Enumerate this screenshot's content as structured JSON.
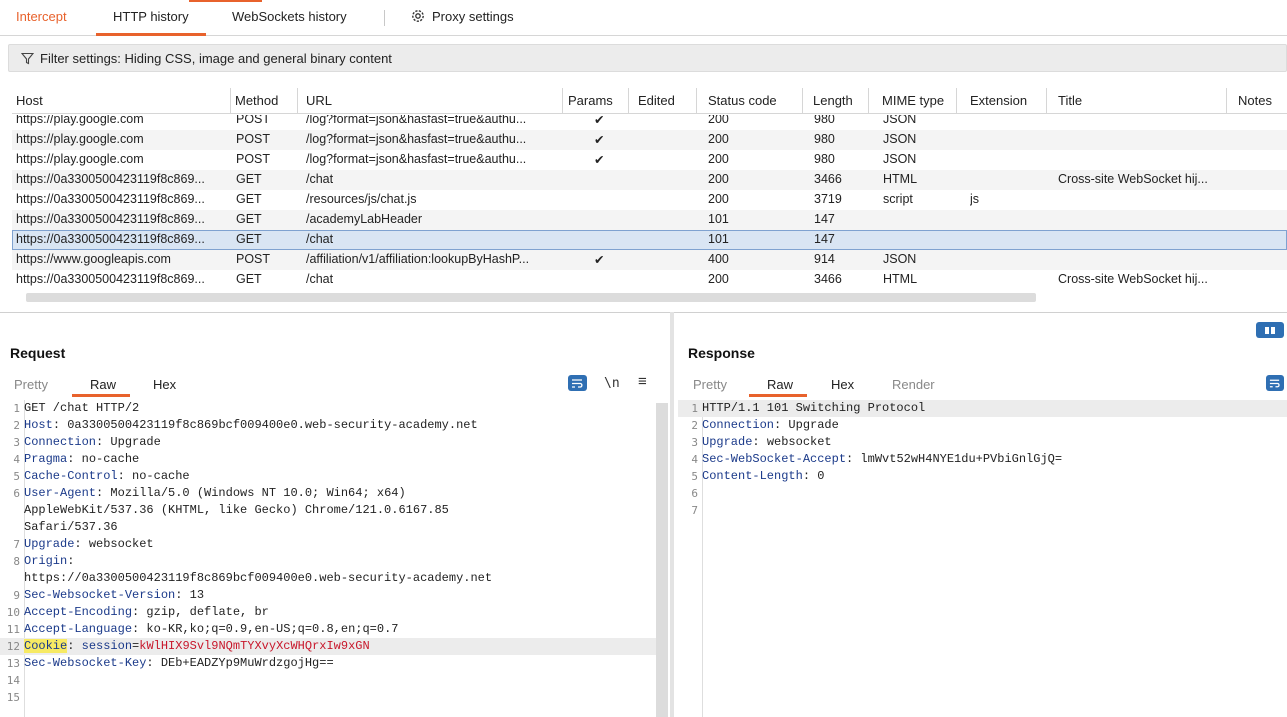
{
  "tabs": {
    "intercept": "Intercept",
    "http_history": "HTTP history",
    "websockets_history": "WebSockets history",
    "proxy_settings": "Proxy settings"
  },
  "filter": {
    "text": "Filter settings: Hiding CSS, image and general binary content"
  },
  "table": {
    "columns": [
      "Host",
      "Method",
      "URL",
      "Params",
      "Edited",
      "Status code",
      "Length",
      "MIME type",
      "Extension",
      "Title",
      "Notes"
    ],
    "rows": [
      {
        "host": "https://play.google.com",
        "method": "POST",
        "url": "/log?format=json&hasfast=true&authu...",
        "params": "✔",
        "edited": "",
        "status": "200",
        "length": "980",
        "mime": "JSON",
        "ext": "",
        "title": ""
      },
      {
        "host": "https://play.google.com",
        "method": "POST",
        "url": "/log?format=json&hasfast=true&authu...",
        "params": "✔",
        "edited": "",
        "status": "200",
        "length": "980",
        "mime": "JSON",
        "ext": "",
        "title": ""
      },
      {
        "host": "https://play.google.com",
        "method": "POST",
        "url": "/log?format=json&hasfast=true&authu...",
        "params": "✔",
        "edited": "",
        "status": "200",
        "length": "980",
        "mime": "JSON",
        "ext": "",
        "title": ""
      },
      {
        "host": "https://0a3300500423119f8c869...",
        "method": "GET",
        "url": "/chat",
        "params": "",
        "edited": "",
        "status": "200",
        "length": "3466",
        "mime": "HTML",
        "ext": "",
        "title": "Cross-site WebSocket hij..."
      },
      {
        "host": "https://0a3300500423119f8c869...",
        "method": "GET",
        "url": "/resources/js/chat.js",
        "params": "",
        "edited": "",
        "status": "200",
        "length": "3719",
        "mime": "script",
        "ext": "js",
        "title": ""
      },
      {
        "host": "https://0a3300500423119f8c869...",
        "method": "GET",
        "url": "/academyLabHeader",
        "params": "",
        "edited": "",
        "status": "101",
        "length": "147",
        "mime": "",
        "ext": "",
        "title": ""
      },
      {
        "host": "https://0a3300500423119f8c869...",
        "method": "GET",
        "url": "/chat",
        "params": "",
        "edited": "",
        "status": "101",
        "length": "147",
        "mime": "",
        "ext": "",
        "title": ""
      },
      {
        "host": "https://www.googleapis.com",
        "method": "POST",
        "url": "/affiliation/v1/affiliation:lookupByHashP...",
        "params": "✔",
        "edited": "",
        "status": "400",
        "length": "914",
        "mime": "JSON",
        "ext": "",
        "title": ""
      },
      {
        "host": "https://0a3300500423119f8c869...",
        "method": "GET",
        "url": "/chat",
        "params": "",
        "edited": "",
        "status": "200",
        "length": "3466",
        "mime": "HTML",
        "ext": "",
        "title": "Cross-site WebSocket hij..."
      }
    ]
  },
  "request": {
    "title": "Request",
    "tabs": [
      "Pretty",
      "Raw",
      "Hex"
    ],
    "newline_label": "\\n",
    "lines": [
      {
        "n": "1",
        "name": "",
        "value": "GET /chat HTTP/2"
      },
      {
        "n": "2",
        "name": "Host",
        "value": ": 0a3300500423119f8c869bcf009400e0.web-security-academy.net"
      },
      {
        "n": "3",
        "name": "Connection",
        "value": ": Upgrade"
      },
      {
        "n": "4",
        "name": "Pragma",
        "value": ": no-cache"
      },
      {
        "n": "5",
        "name": "Cache-Control",
        "value": ": no-cache"
      },
      {
        "n": "6",
        "name": "User-Agent",
        "value": ": Mozilla/5.0 (Windows NT 10.0; Win64; x64)"
      },
      {
        "n": "",
        "name": "",
        "value": "AppleWebKit/537.36 (KHTML, like Gecko) Chrome/121.0.6167.85"
      },
      {
        "n": "",
        "name": "",
        "value": "Safari/537.36"
      },
      {
        "n": "7",
        "name": "Upgrade",
        "value": ": websocket"
      },
      {
        "n": "8",
        "name": "Origin",
        "value": ":"
      },
      {
        "n": "",
        "name": "",
        "value": "https://0a3300500423119f8c869bcf009400e0.web-security-academy.net"
      },
      {
        "n": "9",
        "name": "Sec-Websocket-Version",
        "value": ": 13"
      },
      {
        "n": "10",
        "name": "Accept-Encoding",
        "value": ": gzip, deflate, br"
      },
      {
        "n": "11",
        "name": "Accept-Language",
        "value": ": ko-KR,ko;q=0.9,en-US;q=0.8,en;q=0.7"
      },
      {
        "n": "12",
        "name": "Cookie",
        "value": ": ",
        "cookie_key": "session",
        "cookie_eq": "=",
        "cookie_val": "kWlHIX9Svl9NQmTYXvyXcWHQrxIw9xGN"
      },
      {
        "n": "13",
        "name": "Sec-Websocket-Key",
        "value": ": DEb+EADZYp9MuWrdzgojHg=="
      },
      {
        "n": "14",
        "name": "",
        "value": ""
      },
      {
        "n": "15",
        "name": "",
        "value": ""
      }
    ]
  },
  "response": {
    "title": "Response",
    "tabs": [
      "Pretty",
      "Raw",
      "Hex",
      "Render"
    ],
    "lines": [
      {
        "n": "1",
        "name": "",
        "value": "HTTP/1.1 101 Switching Protocol"
      },
      {
        "n": "2",
        "name": "Connection",
        "value": ": Upgrade"
      },
      {
        "n": "3",
        "name": "Upgrade",
        "value": ": websocket"
      },
      {
        "n": "4",
        "name": "Sec-WebSocket-Accept",
        "value": ": lmWvt52wH4NYE1du+PVbiGnlGjQ="
      },
      {
        "n": "5",
        "name": "Content-Length",
        "value": ": 0"
      },
      {
        "n": "6",
        "name": "",
        "value": ""
      },
      {
        "n": "7",
        "name": "",
        "value": ""
      }
    ]
  },
  "colors": {
    "accent": "#e8622c",
    "selection": "#d9e5f3",
    "header_name": "#1b3a8a",
    "cookie_value": "#c8172b",
    "button_blue": "#2f6fb3"
  }
}
